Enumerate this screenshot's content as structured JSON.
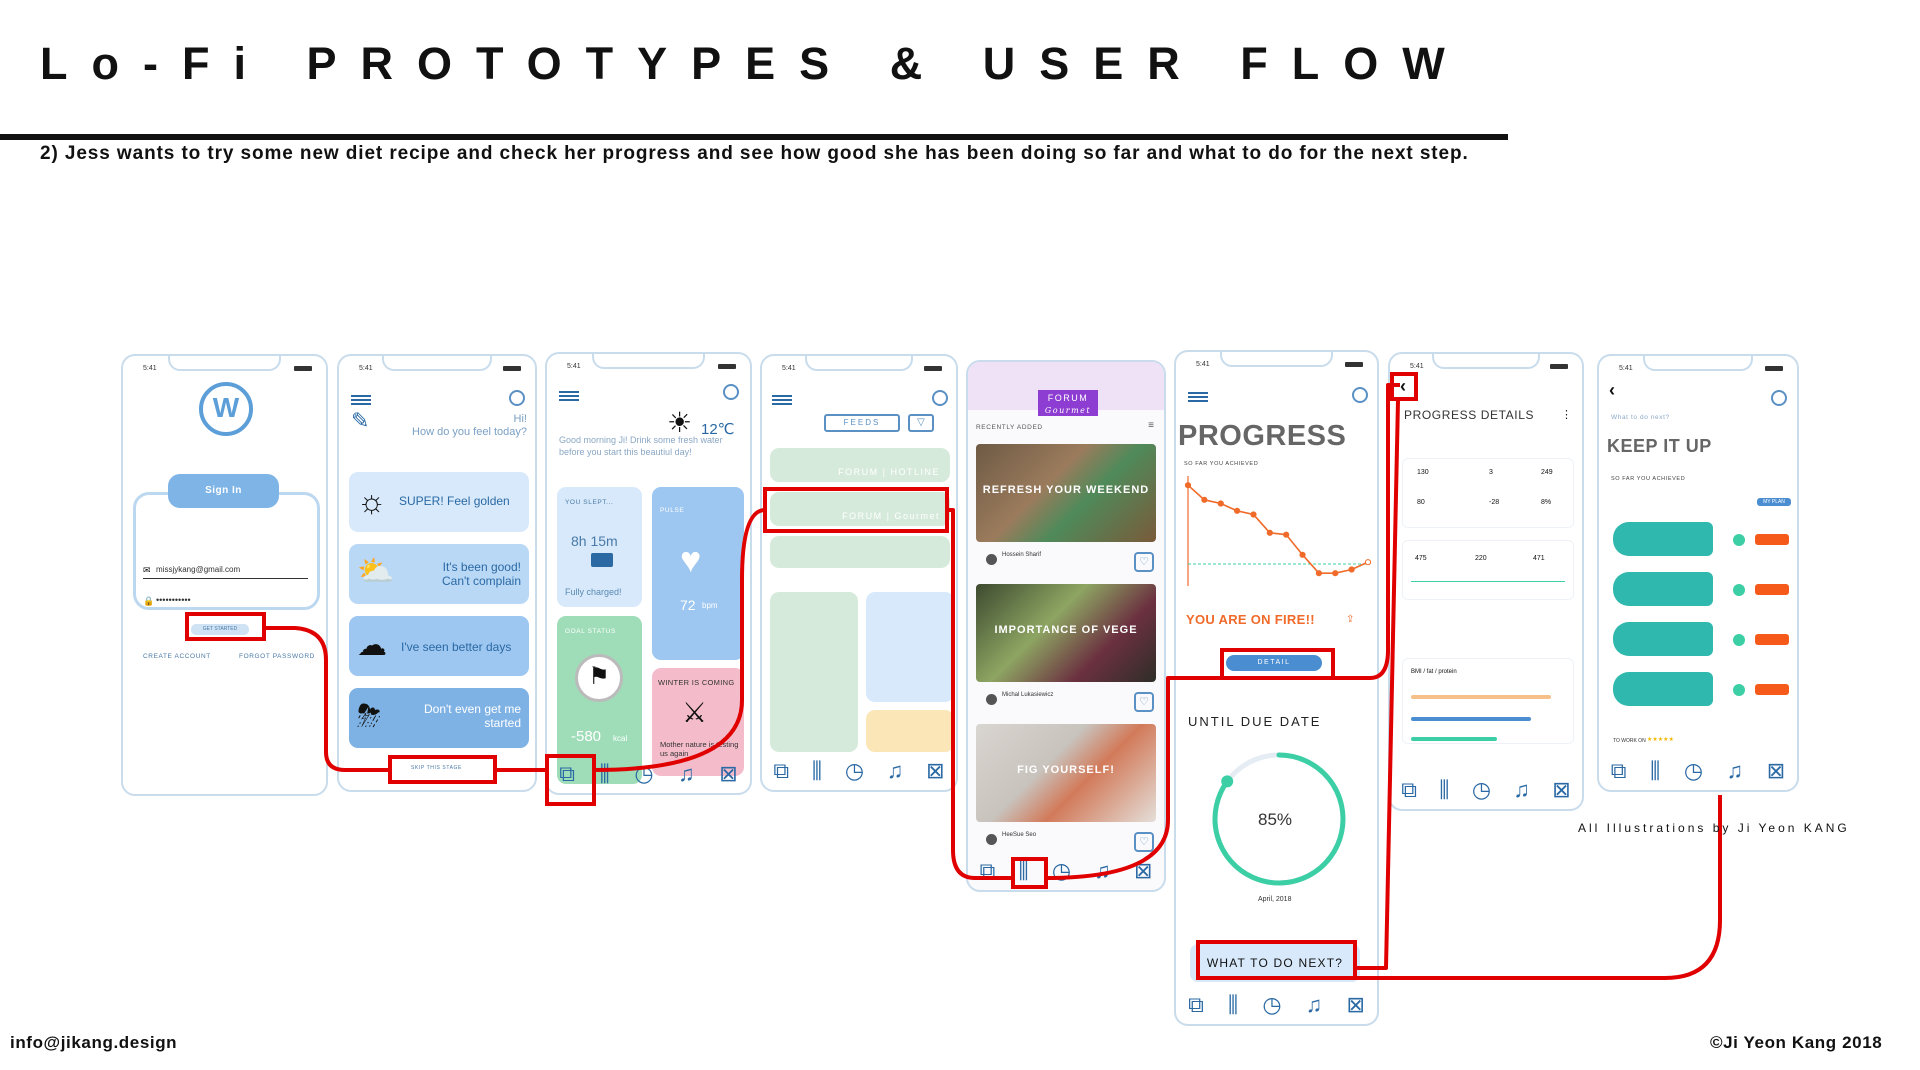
{
  "header": {
    "title": "Lo-Fi PROTOTYPES & USER FLOW",
    "subtitle": "2) Jess wants to try some new diet recipe and check her progress and see how good she has been doing so far and what to do for the next step."
  },
  "footer": {
    "email": "info@jikang.design",
    "copyright": "©Ji Yeon Kang 2018",
    "illustration_credit": "All Illustrations by Ji Yeon KANG"
  },
  "phones": {
    "status_time": "5:41",
    "signin": {
      "sign_in_button": "Sign In",
      "email": "missjykang@gmail.com",
      "password": "•••••••••••",
      "get_started": "GET STARTED",
      "create_account": "CREATE ACCOUNT",
      "forgot_password": "FORGOT PASSWORD"
    },
    "mood": {
      "greeting": "Hi!",
      "question": "How do you feel today?",
      "options": [
        "SUPER! Feel golden",
        "It's been good! Can't complain",
        "I've seen better days",
        "Don't even get me started"
      ],
      "skip": "SKIP THIS STAGE"
    },
    "dashboard": {
      "greeting": "Good morning Ji! Drink some fresh water before you start this beautiul day!",
      "temperature": "12℃",
      "sleep_label": "YOU SLEPT...",
      "sleep_value": "8h 15m",
      "battery_text": "Fully charged!",
      "pulse_label": "PULSE",
      "pulse_value": "72",
      "pulse_unit": "bpm",
      "goal_label": "GOAL STATUS",
      "goal_value": "-580",
      "goal_unit": "kcal",
      "winter_title": "WINTER IS COMING",
      "winter_text": "Mother nature is testing us again"
    },
    "feeds": {
      "title": "FEEDS",
      "rows": [
        "FORUM | HOTLINE",
        "FORUM | Gourmet"
      ]
    },
    "forum": {
      "title": "FORUM",
      "script_label": "Gourmet",
      "recently_added": "RECENTLY ADDED",
      "posts": [
        {
          "title": "REFRESH YOUR WEEKEND",
          "author": "Hossein Sharif"
        },
        {
          "title": "IMPORTANCE OF VEGE",
          "author": "Michal Lukasiewicz"
        },
        {
          "title": "FIG YOURSELF!",
          "author": "HeeSue Seo"
        }
      ]
    },
    "progress": {
      "title": "PROGRESS",
      "so_far": "SO FAR YOU ACHIEVED",
      "fire": "YOU ARE ON FIRE!!",
      "detail_button": "DETAIL",
      "due_label": "UNTIL DUE DATE",
      "percent": "85%",
      "date": "April, 2018",
      "next_button": "WHAT TO DO NEXT?"
    },
    "details": {
      "title": "PROGRESS DETAILS",
      "stats": [
        "130",
        "3",
        "249",
        "80",
        "-28",
        "8%"
      ],
      "variables": [
        "475",
        "220",
        "471"
      ],
      "bmi_label": "BMI / fat / protein"
    },
    "plan": {
      "prompt": "What to do next?",
      "title": "KEEP IT UP",
      "so_far": "SO FAR YOU ACHIEVED",
      "my_plan": "MY PLAN",
      "work_on": "TO WORK ON"
    }
  },
  "chart_data": {
    "type": "line",
    "series": [
      {
        "values": [
          100,
          92,
          90,
          86,
          84,
          74,
          73,
          62,
          52,
          52,
          54,
          58
        ]
      }
    ],
    "goal_line": 57
  },
  "ring_data": {
    "percent": 85
  },
  "colors": {
    "flow_line": "#e00000",
    "card_blue": "#d7e9fa",
    "accent_orange": "#f06a2a",
    "mint": "#3ccfa6"
  }
}
